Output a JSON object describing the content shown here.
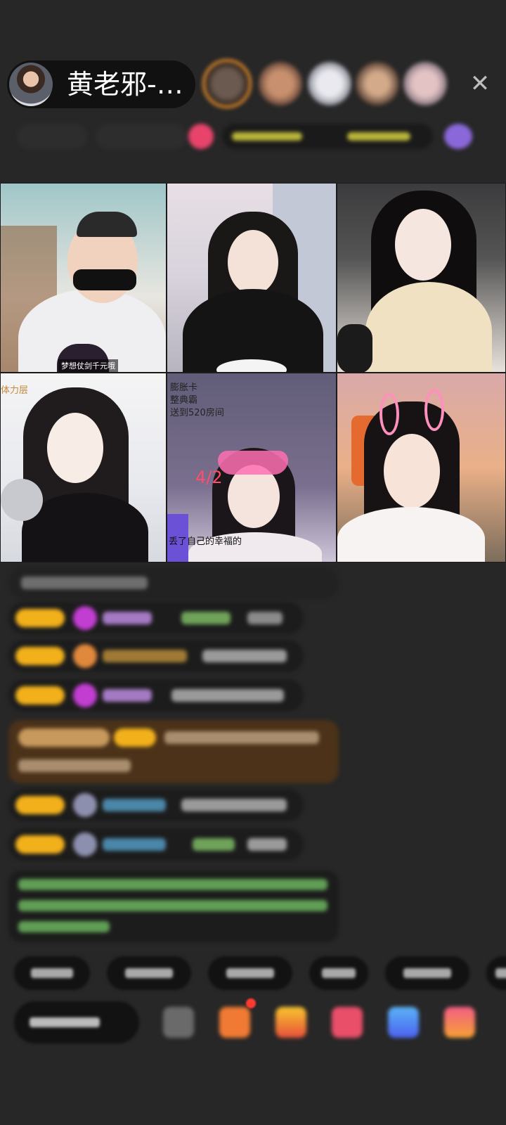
{
  "header": {
    "host_name": "黄老邪-…",
    "close_icon": "close-icon"
  },
  "video_tiles": [
    {
      "caption": "梦想仗剑千元哦"
    },
    {
      "caption": ""
    },
    {
      "caption": ""
    },
    {
      "caption": "体力层",
      "emoji": ""
    },
    {
      "lines": [
        "膨胀卡",
        "整典霸",
        "送到520房间"
      ],
      "counter": "4/2",
      "subtitle": "丢了自己的幸福的"
    },
    {
      "caption": ""
    }
  ]
}
